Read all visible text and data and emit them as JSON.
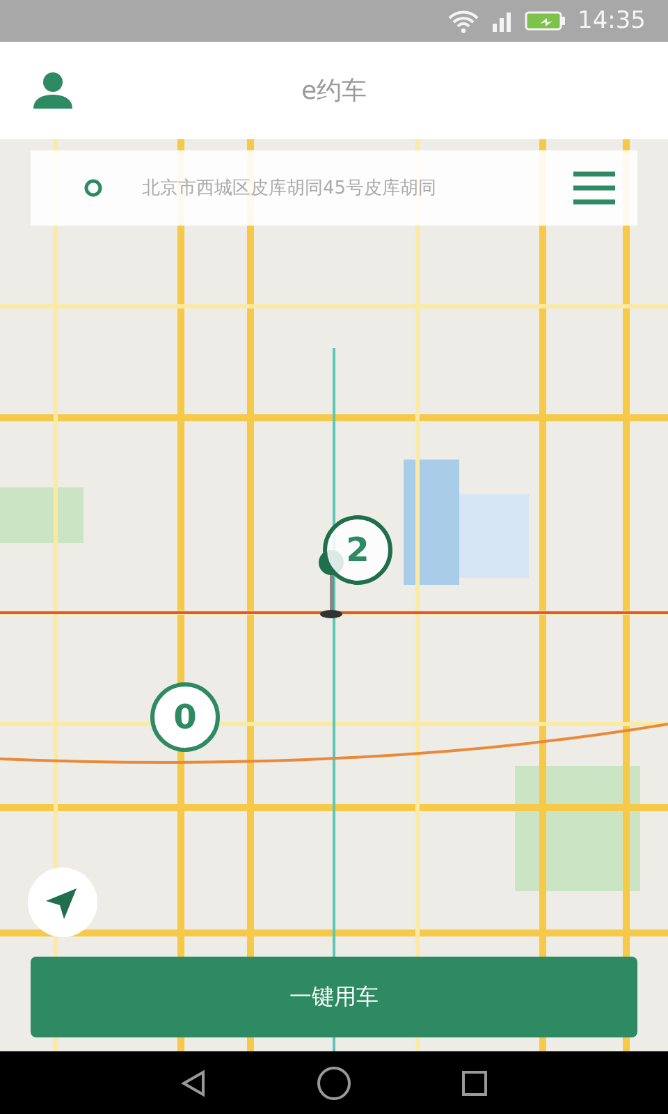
{
  "status_bar": {
    "time": "14:35"
  },
  "header": {
    "title": "e约车"
  },
  "search": {
    "value": "北京市西城区皮库胡同45号皮库胡同"
  },
  "map": {
    "markers": [
      {
        "count": "2",
        "selected": true
      },
      {
        "count": "0",
        "selected": false
      }
    ]
  },
  "primary_button": {
    "label": "一键用车"
  }
}
